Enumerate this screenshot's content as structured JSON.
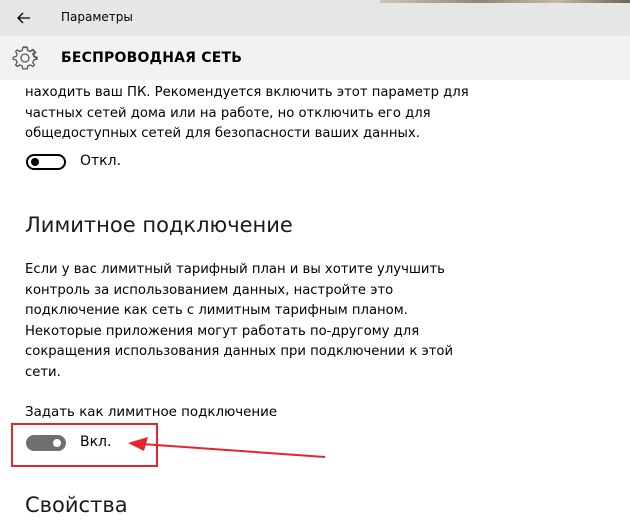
{
  "window": {
    "title": "Параметры",
    "back_icon": "arrow-left-icon"
  },
  "header": {
    "title": "БЕСПРОВОДНАЯ СЕТЬ",
    "icon": "gear-icon"
  },
  "discovery": {
    "lines": [
      "находить ваш ПК. Рекомендуется включить этот параметр для",
      "частных сетей дома или на работе, но отключить его для",
      "общедоступных сетей для безопасности ваших данных."
    ],
    "toggle_state": "off",
    "toggle_label": "Откл."
  },
  "metered": {
    "heading": "Лимитное подключение",
    "lines": [
      "Если у вас лимитный тарифный план и вы хотите улучшить",
      "контроль за использованием данных, настройте это",
      "подключение как сеть с лимитным тарифным планом.",
      "Некоторые приложения могут работать по-другому для",
      "сокращения использования данных при подключении к этой",
      "сети."
    ],
    "setting_label": "Задать как лимитное подключение",
    "toggle_state": "on",
    "toggle_label": "Вкл."
  },
  "properties": {
    "heading": "Свойства"
  },
  "colors": {
    "annotation": "#e4262c",
    "toggle_on": "#707070"
  }
}
